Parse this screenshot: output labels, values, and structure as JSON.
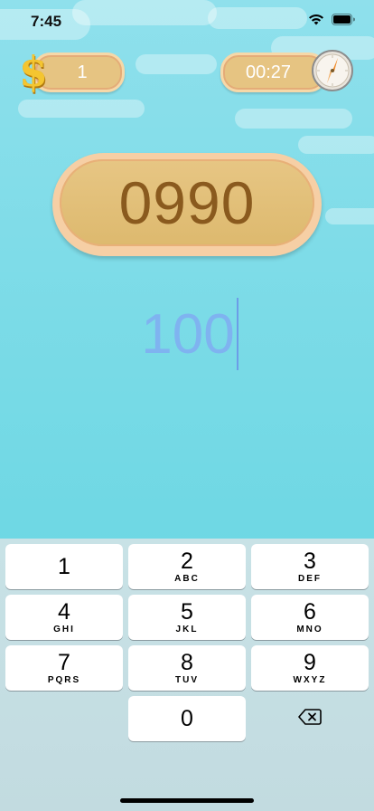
{
  "status_bar": {
    "time": "7:45",
    "wifi_icon": "wifi-icon",
    "battery_icon": "battery-icon"
  },
  "hud": {
    "score": "1",
    "score_icon": "dollar-icon",
    "timer": "00:27",
    "timer_icon": "compass-icon"
  },
  "target": {
    "value": "0990"
  },
  "answer": {
    "value": "100"
  },
  "keyboard": {
    "keys": [
      {
        "digit": "1",
        "letters": ""
      },
      {
        "digit": "2",
        "letters": "ABC"
      },
      {
        "digit": "3",
        "letters": "DEF"
      },
      {
        "digit": "4",
        "letters": "GHI"
      },
      {
        "digit": "5",
        "letters": "JKL"
      },
      {
        "digit": "6",
        "letters": "MNO"
      },
      {
        "digit": "7",
        "letters": "PQRS"
      },
      {
        "digit": "8",
        "letters": "TUV"
      },
      {
        "digit": "9",
        "letters": "WXYZ"
      },
      {
        "digit": "0",
        "letters": ""
      }
    ],
    "delete_icon": "backspace-icon"
  },
  "colors": {
    "sky_top": "#8fe0ec",
    "sky_bottom": "#62d3df",
    "pill_fill": "#e6c482",
    "target_text": "#8a5a1e",
    "answer_text": "#7fb3f0",
    "keyboard_bg": "#c8e2e6"
  }
}
